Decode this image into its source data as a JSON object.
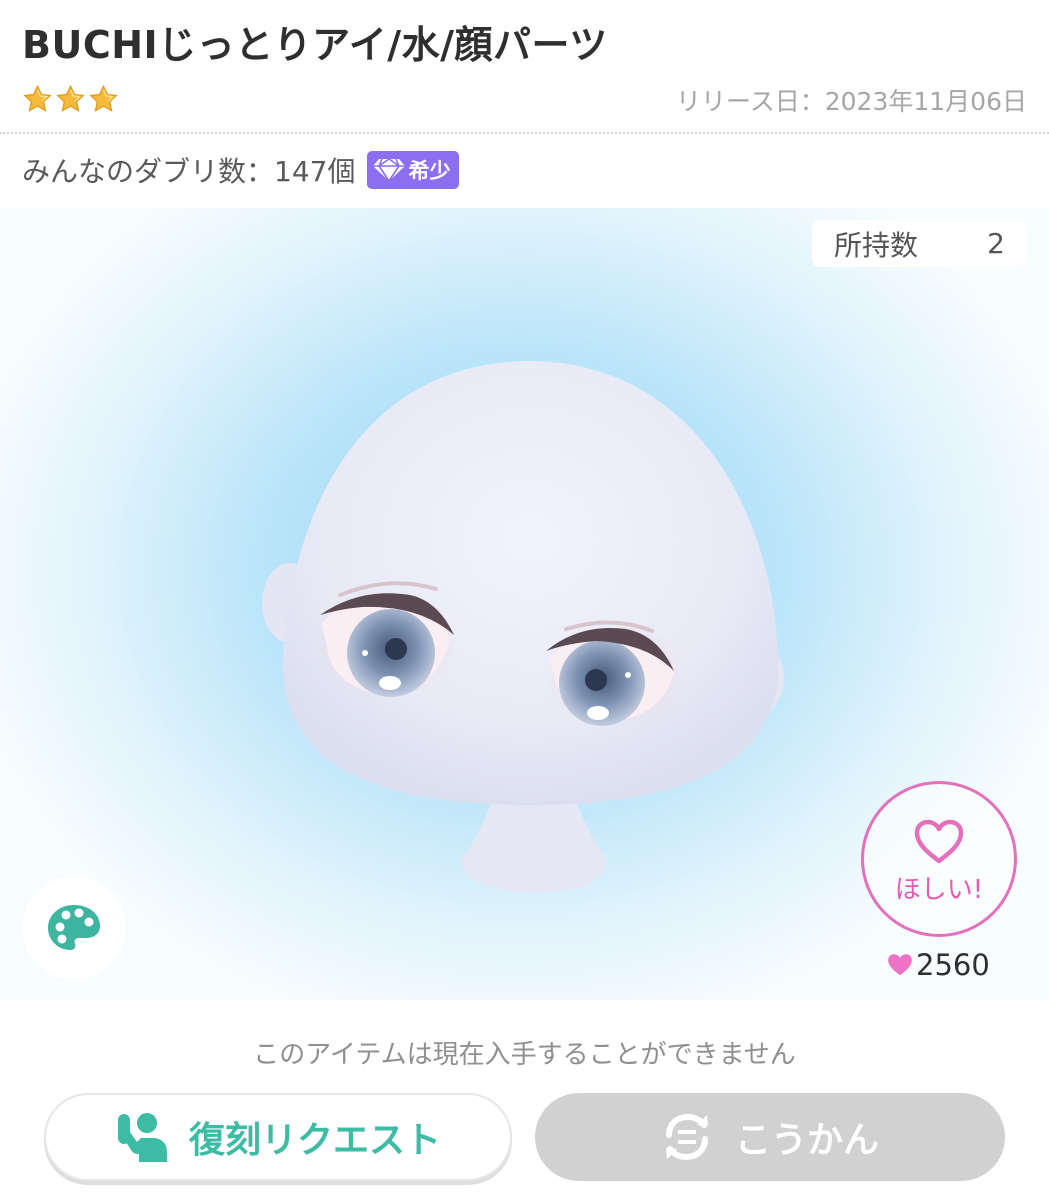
{
  "item": {
    "name": "BUCHIじっとりアイ/水/顔パーツ",
    "rarity_stars": 3,
    "release_label": "リリース日：2023年11月06日",
    "duplicate_label": "みんなのダブリ数：147個",
    "rare_badge_label": "希少",
    "owned_label": "所持数",
    "owned_count": "2"
  },
  "actions": {
    "want_label": "ほしい!",
    "like_count": "2560",
    "unavailable_notice": "このアイテムは現在入手することができません",
    "request_label": "復刻リクエスト",
    "exchange_label": "こうかん"
  },
  "icons": {
    "stars": "star-icon",
    "rare_badge": "diamond-icon",
    "palette": "palette-icon",
    "want": "heart-outline-icon",
    "like": "heart-icon",
    "request": "person-raising-hand-icon",
    "exchange": "exchange-arrows-icon"
  },
  "colors": {
    "star": "#f6b93b",
    "rare_badge": "#8b6ff0",
    "want_accent": "#e36fbd",
    "request_text": "#3cbba5",
    "exchange_disabled": "#d1d1d1"
  }
}
